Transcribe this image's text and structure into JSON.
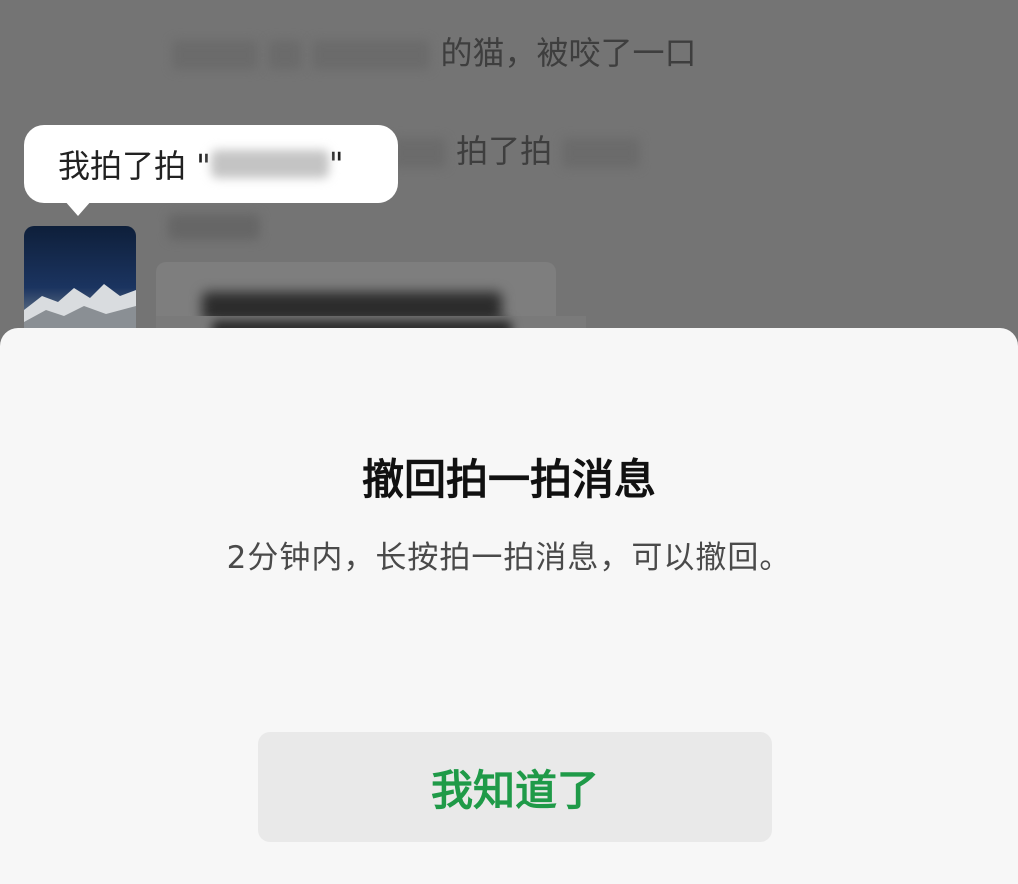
{
  "chat": {
    "system_line_1_suffix": "的猫，被咬了一口",
    "system_line_2_middle": "拍了拍",
    "pat_tip_text": "我拍了拍 \"",
    "pat_tip_close": "\""
  },
  "dialog": {
    "title": "撤回拍一拍消息",
    "description": "2分钟内，长按拍一拍消息，可以撤回。",
    "ok_label": "我知道了"
  },
  "colors": {
    "accent_green": "#1f9a48",
    "overlay": "#747474",
    "sheet_bg": "#f7f7f7"
  }
}
